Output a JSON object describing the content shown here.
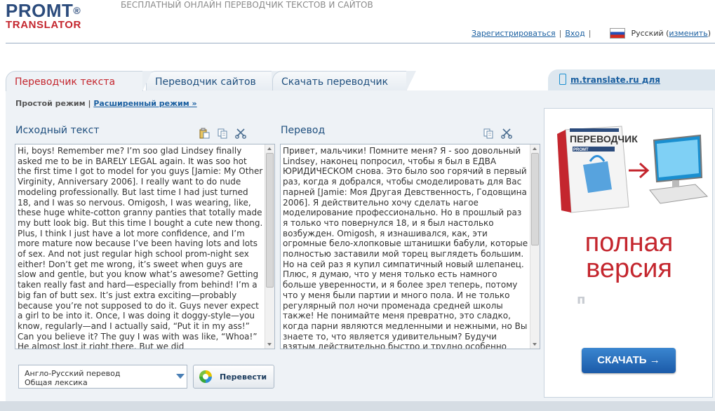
{
  "header": {
    "logo_main": "PROMT",
    "logo_reg": "®",
    "logo_sub": "TRANSLATOR",
    "tagline": "БЕСПЛАТНЫЙ ОНЛАЙН ПЕРЕВОДЧИК ТЕКСТОВ И САЙТОВ",
    "register_link": "Зарегистрироваться",
    "login_link": "Вход",
    "language_prefix": "Русский (",
    "change_link": "изменить",
    "language_suffix": ")"
  },
  "tabs": [
    {
      "label": "Переводчик текста",
      "active": true
    },
    {
      "label": "Переводчик сайтов",
      "active": false
    },
    {
      "label": "Скачать переводчик",
      "active": false
    }
  ],
  "mobile_link": "m.translate.ru для мобильных",
  "modes": {
    "simple": "Простой режим",
    "separator": "|",
    "advanced": "Расширенный режим »"
  },
  "source": {
    "title": "Исходный текст",
    "text": "Hi, boys! Remember me? I’m soo glad Lindsey finally asked me to be in BARELY LEGAL again. It was soo hot the first time I got to model for you guys [Jamie: My Other Virginity, Anniversary 2006]. I really want to do nude modeling professionally. But last time I had just turned 18, and I was so nervous. Omigosh, I was wearing, like, these huge white-cotton granny panties that totally made my butt look big. But this time I bought a cute new thong. Plus, I think I just have a lot more confidence, and I’m more mature now because I’ve been having lots and lots of sex. And not just regular high school prom-night sex either! Don’t get me wrong, it’s sweet when guys are slow and gentle, but you know what’s awesome? Getting taken really fast and hard—especially from behind! I’m a big fan of butt sex. It’s just extra exciting—probably because you’re not supposed to do it. Guys never expect a girl to be into it. Once, I was doing it doggy-style—you know, regularly—and I actually said, “Put it in my ass!” Can you believe it? The guy I was with was like, “Whoa!” He almost lost it right there. But we did"
  },
  "target": {
    "title": "Перевод",
    "text": "Привет, мальчики! Помните меня? Я - soo довольный Lindsey, наконец попросил, чтобы я был в ЕДВА ЮРИДИЧЕСКОМ снова. Это было soo горячий в первый раз, когда я добрался, чтобы смоделировать для Вас парней [Jamie: Моя Другая Девственность, Годовщина 2006]. Я действительно хочу сделать нагое моделирование профессионально. Но в прошлый раз я только что повернулся 18, и я был настолько возбужден. Omigosh, я изнашивался, как, эти огромные бело-хлопковые штанишки бабули, которые полностью заставили мой торец выглядеть большим. Но на сей раз я купил симпатичный новый шлепанец. Плюс, я думаю, что у меня только есть намного больше уверенности, и я более зрел теперь, потому что у меня были партии и много пола. И не только регулярный пол ночи променада средней школы также! Не понимайте меня превратно, это сладко, когда парни являются медленными и нежными, но Вы знаете то, что является удивительным? Будучи взятым действительно быстро и трудно особенно сзади! Я -"
  },
  "direction_select": {
    "line1": "Англо-Русский перевод",
    "line2": "Общая лексика"
  },
  "translate_button": "Перевести",
  "ad": {
    "box_title": "ПЕРЕВОДЧИК",
    "box_brand": "PROMT",
    "headline1": "полная",
    "headline2": "версия",
    "mini": "п",
    "download_button": "СКАЧАТЬ →"
  },
  "colors": {
    "brand_blue": "#2b4b7c",
    "brand_red": "#c4262e",
    "link": "#1a5fa0",
    "panel_bg": "#eef2f6"
  }
}
